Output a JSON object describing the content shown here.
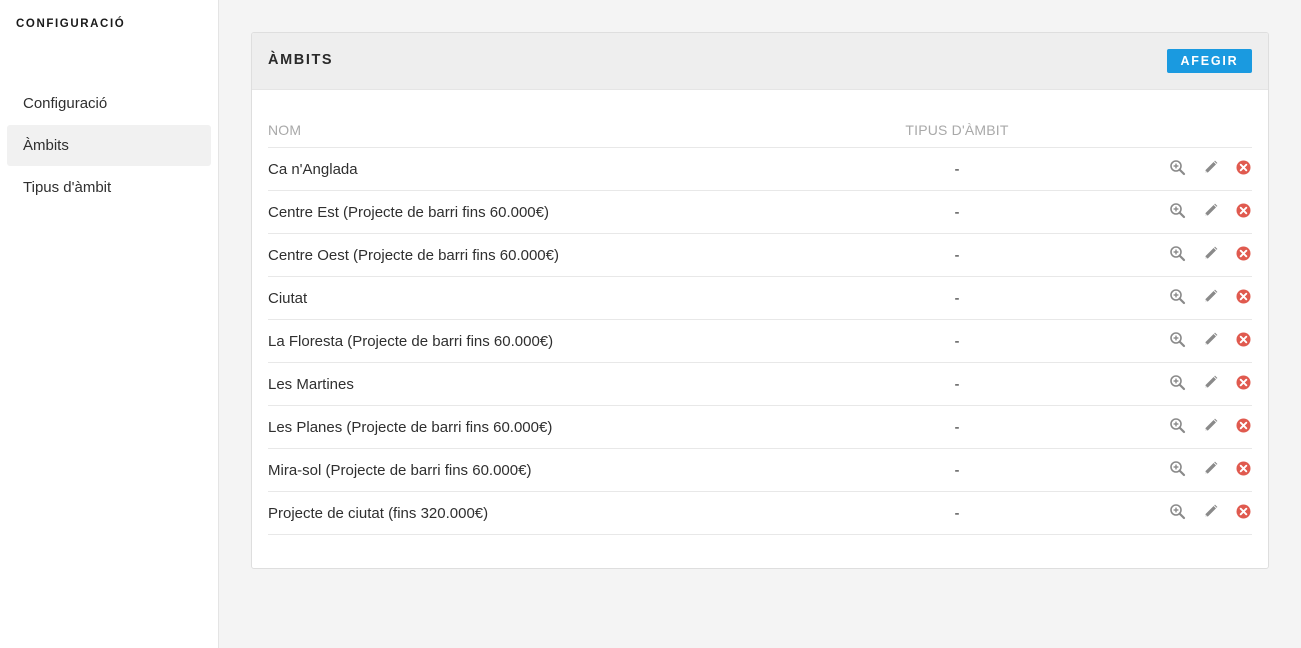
{
  "sidebar": {
    "title": "CONFIGURACIÓ",
    "items": [
      {
        "label": "Configuració",
        "active": false
      },
      {
        "label": "Àmbits",
        "active": true
      },
      {
        "label": "Tipus d'àmbit",
        "active": false
      }
    ]
  },
  "panel": {
    "title": "ÀMBITS",
    "add_label": "AFEGIR"
  },
  "table": {
    "columns": [
      "NOM",
      "TIPUS D'ÀMBIT"
    ],
    "rows": [
      {
        "name": "Ca n'Anglada",
        "type": "-"
      },
      {
        "name": "Centre Est (Projecte de barri fins 60.000€)",
        "type": "-"
      },
      {
        "name": "Centre Oest (Projecte de barri fins 60.000€)",
        "type": "-"
      },
      {
        "name": "Ciutat",
        "type": "-"
      },
      {
        "name": "La Floresta (Projecte de barri fins 60.000€)",
        "type": "-"
      },
      {
        "name": "Les Martines",
        "type": "-"
      },
      {
        "name": "Les Planes (Projecte de barri fins 60.000€)",
        "type": "-"
      },
      {
        "name": "Mira-sol (Projecte de barri fins 60.000€)",
        "type": "-"
      },
      {
        "name": "Projecte de ciutat (fins 320.000€)",
        "type": "-"
      }
    ],
    "row_icons": [
      "zoom-in-icon",
      "pencil-icon",
      "delete-circle-icon"
    ]
  },
  "colors": {
    "accent": "#1a9ae0",
    "delete": "#e05a4f",
    "icon": "#8a8a8a",
    "sidebar_active": "#f1f1f1",
    "background": "#f4f4f4"
  }
}
